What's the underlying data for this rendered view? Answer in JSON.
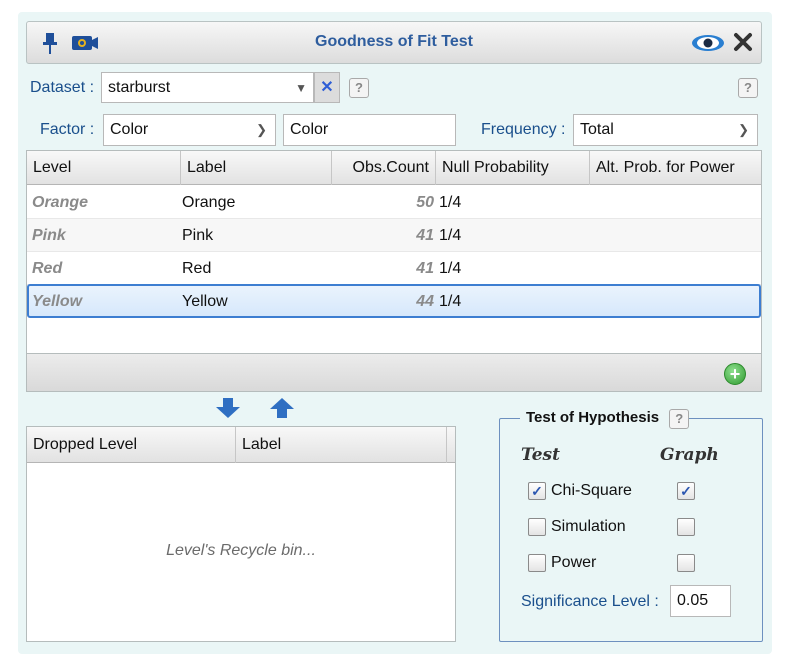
{
  "window": {
    "title": "Goodness of Fit Test",
    "icons": [
      "pin-icon",
      "camera-icon",
      "eye-icon",
      "close-icon"
    ]
  },
  "dataset": {
    "label": "Dataset :",
    "value": "starburst",
    "help": "?",
    "right_help": "?"
  },
  "factor": {
    "label": "Factor :",
    "value": "Color",
    "label_input": "Color",
    "frequency_label": "Frequency :",
    "frequency_value": "Total"
  },
  "levels_table": {
    "columns": [
      "Level",
      "Label",
      "Obs.Count",
      "Null Probability",
      "Alt. Prob. for Power"
    ],
    "rows": [
      {
        "level": "Orange",
        "label": "Orange",
        "count": "50",
        "null_prob": "1/4",
        "alt_prob": ""
      },
      {
        "level": "Pink",
        "label": "Pink",
        "count": "41",
        "null_prob": "1/4",
        "alt_prob": ""
      },
      {
        "level": "Red",
        "label": "Red",
        "count": "41",
        "null_prob": "1/4",
        "alt_prob": ""
      },
      {
        "level": "Yellow",
        "label": "Yellow",
        "count": "44",
        "null_prob": "1/4",
        "alt_prob": ""
      }
    ],
    "selected_row": "Yellow"
  },
  "recycle_bin": {
    "columns": [
      "Dropped Level",
      "Label"
    ],
    "empty_message": "Level's Recycle bin..."
  },
  "hypothesis": {
    "title": "Test of Hypothesis",
    "help": "?",
    "col_test": "Test",
    "col_graph": "Graph",
    "tests": [
      {
        "name": "Chi-Square",
        "test_checked": true,
        "graph_checked": true
      },
      {
        "name": "Simulation",
        "test_checked": false,
        "graph_checked": false
      },
      {
        "name": "Power",
        "test_checked": false,
        "graph_checked": false
      }
    ],
    "significance_label": "Significance Level :",
    "significance_value": "0.05"
  },
  "colors": {
    "accent": "#2e5d9e",
    "selection_border": "#3d7ed1",
    "panel_bg": "#eaf6f6"
  }
}
